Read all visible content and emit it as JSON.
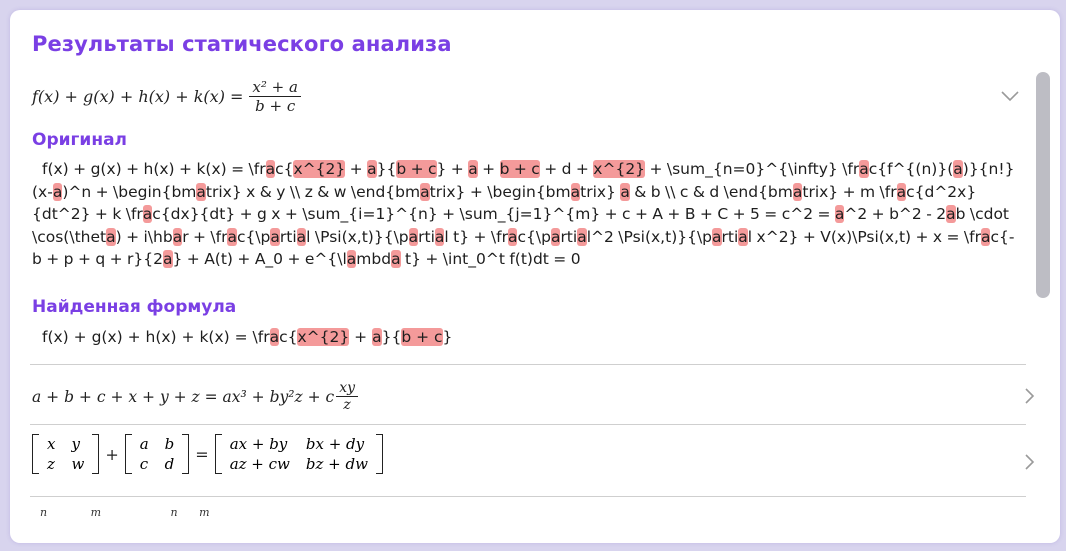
{
  "title": "Результаты статического анализа",
  "entries": [
    {
      "formula_parts": {
        "lhs": "f(x) + g(x) + h(x) + k(x) =",
        "num": "x² + a",
        "den": "b + c"
      }
    },
    {
      "formula": "a + b + c + x + y + z = ax³ + by²z + c",
      "frac": {
        "num": "xy",
        "den": "z"
      }
    },
    {
      "lhs_a": [
        [
          "x",
          "y"
        ],
        [
          "z",
          "w"
        ]
      ],
      "lhs_b": [
        [
          "a",
          "b"
        ],
        [
          "c",
          "d"
        ]
      ],
      "rhs": [
        [
          "ax + by",
          "bx + dy"
        ],
        [
          "az + cw",
          "bz + dw"
        ]
      ]
    }
  ],
  "section_original": "Оригинал",
  "section_found": "Найденная формула",
  "original_text": "f(x) + g(x) + h(x) + k(x) = \\frac{x^{2} + a}{b + c} + a + b + c + d + x^{2} + \\sum_{n=0}^{\\infty} \\frac{f^{(n)}(a)}{n!}(x-a)^n + \\begin{bmatrix} x & y \\\\ z & w \\end{bmatrix} + \\begin{bmatrix} a & b \\\\ c & d \\end{bmatrix} + m \\frac{d^2x}{dt^2} + k \\frac{dx}{dt} + g x + \\sum_{i=1}^{n} + \\sum_{j=1}^{m} + c + A + B + C + 5 = c^2 = a^2 + b^2 - 2ab \\cdot \\cos(\\theta) + i\\hbar + \\frac{\\partial \\Psi(x,t)}{\\partial t} + \\frac{\\partial^2 \\Psi(x,t)}{\\partial x^2} + V(x)\\Psi(x,t) + x = \\frac{-b + p + q + r}{2a} + A(t) + A_0 + e^{\\lambda t} + \\int_0^t f(t)dt = 0",
  "found_text": "f(x) + g(x) + h(x) + k(x) = \\frac{x^{2} + a}{b + c}",
  "partial_row": [
    "n",
    "m",
    "n",
    "m"
  ],
  "colors": {
    "accent": "#7a3fe4",
    "highlight": "#f49a9a",
    "background": "#d8d4ee"
  },
  "icons": [
    "chevron-down-icon",
    "chevron-right-icon",
    "chevron-right-icon"
  ]
}
